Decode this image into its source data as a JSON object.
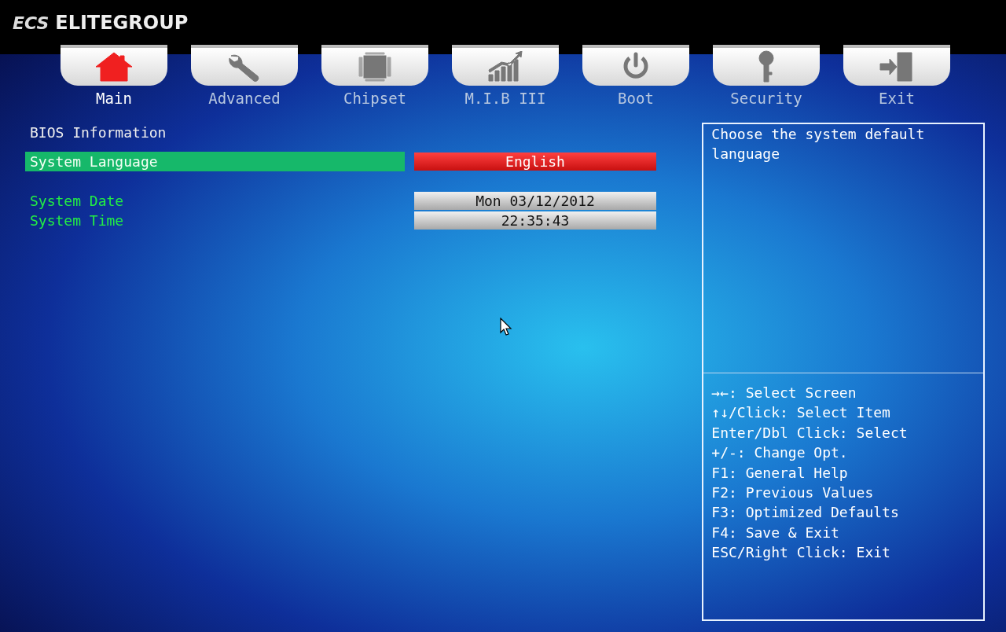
{
  "brand": {
    "logo": "ECS",
    "name": "ELITEGROUP"
  },
  "tabs": [
    {
      "label": "Main",
      "kind": "house",
      "selected": true
    },
    {
      "label": "Advanced",
      "kind": "wrench",
      "selected": false
    },
    {
      "label": "Chipset",
      "kind": "chip",
      "selected": false
    },
    {
      "label": "M.I.B III",
      "kind": "chart",
      "selected": false
    },
    {
      "label": "Boot",
      "kind": "power",
      "selected": false
    },
    {
      "label": "Security",
      "kind": "key",
      "selected": false
    },
    {
      "label": "Exit",
      "kind": "door",
      "selected": false
    }
  ],
  "items": [
    {
      "kind": "heading",
      "label": "BIOS Information"
    },
    {
      "kind": "option",
      "label": "System Language",
      "value": "English",
      "selected": true
    },
    {
      "kind": "field",
      "label": "System Date",
      "value": "Mon 03/12/2012",
      "selected": false
    },
    {
      "kind": "field",
      "label": "System Time",
      "value": "22:35:43",
      "selected": false
    }
  ],
  "help": {
    "description": "Choose the system default language",
    "keys": [
      "→←: Select Screen",
      "↑↓/Click: Select Item",
      "Enter/Dbl Click: Select",
      "+/-: Change Opt.",
      "F1: General Help",
      "F2: Previous Values",
      "F3: Optimized Defaults",
      "F4: Save & Exit",
      "ESC/Right Click: Exit"
    ]
  }
}
